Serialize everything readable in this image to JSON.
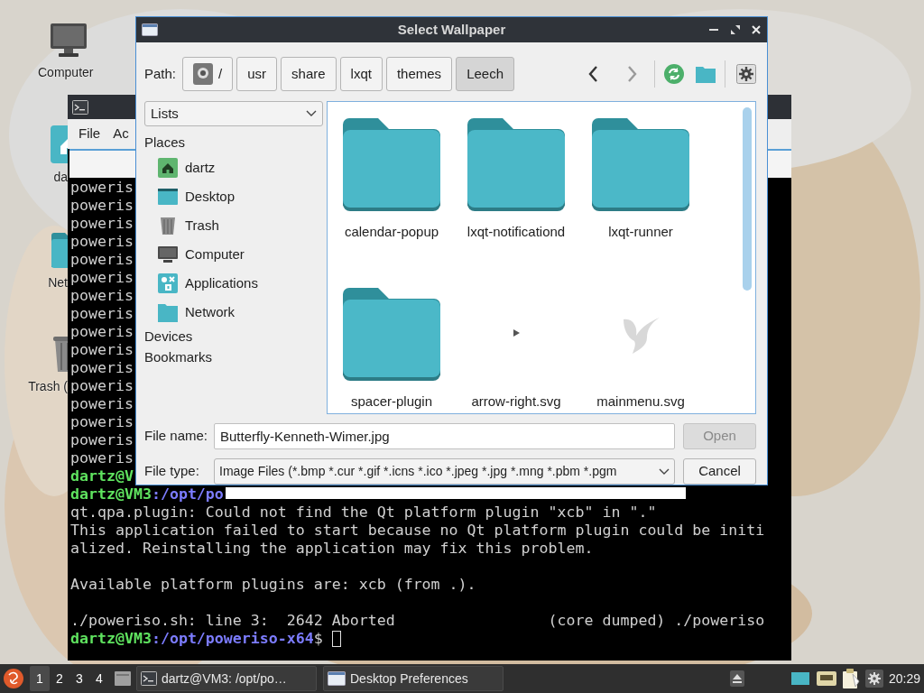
{
  "desktop_icons": [
    {
      "label": "Computer",
      "kind": "computer"
    },
    {
      "label": "da",
      "kind": "home"
    },
    {
      "label": "Net",
      "kind": "network"
    },
    {
      "label": "Trash (",
      "kind": "trash"
    }
  ],
  "terminal": {
    "menu": [
      "File",
      "Ac"
    ],
    "lines": [
      {
        "kind": "output",
        "text": "poweris"
      },
      {
        "kind": "output",
        "text": "poweris"
      },
      {
        "kind": "output",
        "text": "poweris"
      },
      {
        "kind": "output",
        "text": "poweris"
      },
      {
        "kind": "output",
        "text": "poweris"
      },
      {
        "kind": "output",
        "text": "poweris"
      },
      {
        "kind": "output",
        "text": "poweris"
      },
      {
        "kind": "output",
        "text": "poweris"
      },
      {
        "kind": "output",
        "text": "poweris"
      },
      {
        "kind": "output",
        "text": "poweris"
      },
      {
        "kind": "output",
        "text": "poweris"
      },
      {
        "kind": "output",
        "text": "poweris"
      },
      {
        "kind": "output",
        "text": "poweris"
      },
      {
        "kind": "output",
        "text": "poweris"
      },
      {
        "kind": "output",
        "text": "poweris"
      },
      {
        "kind": "output",
        "text": "poweris"
      },
      {
        "kind": "prompt",
        "user": "dartz@V"
      },
      {
        "kind": "prompt",
        "user": "dartz@VM3",
        "path": ":/opt/po"
      },
      {
        "kind": "output",
        "text": "qt.qpa.plugin: Could not find the Qt platform plugin \"xcb\" in \".\""
      },
      {
        "kind": "output",
        "text": "This application failed to start because no Qt platform plugin could be initi"
      },
      {
        "kind": "output",
        "text": "alized. Reinstalling the application may fix this problem."
      },
      {
        "kind": "blank"
      },
      {
        "kind": "output",
        "text": "Available platform plugins are: xcb (from .)."
      },
      {
        "kind": "blank"
      },
      {
        "kind": "output",
        "text": "./poweriso.sh: line 3:  2642 Aborted                 (core dumped) ./poweriso"
      },
      {
        "kind": "prompt",
        "user": "dartz@VM3",
        "path": ":/opt/poweriso-x64",
        "tail": "$ ",
        "cursor": true
      }
    ]
  },
  "dialog": {
    "title": "Select Wallpaper",
    "path_label": "Path:",
    "breadcrumbs": [
      {
        "label": "/",
        "kind": "root",
        "selected": false
      },
      {
        "label": "usr",
        "kind": "dir",
        "selected": false
      },
      {
        "label": "share",
        "kind": "dir",
        "selected": false
      },
      {
        "label": "lxqt",
        "kind": "dir",
        "selected": false
      },
      {
        "label": "themes",
        "kind": "dir",
        "selected": false
      },
      {
        "label": "Leech",
        "kind": "dir",
        "selected": true
      }
    ],
    "nav_buttons": [
      {
        "kind": "back",
        "disabled": false
      },
      {
        "kind": "forward",
        "disabled": true
      }
    ],
    "view_combo": "Lists",
    "sections": [
      {
        "title": "Places",
        "items": [
          {
            "label": "dartz",
            "kind": "home"
          },
          {
            "label": "Desktop",
            "kind": "desktop"
          },
          {
            "label": "Trash",
            "kind": "trash"
          },
          {
            "label": "Computer",
            "kind": "computer"
          },
          {
            "label": "Applications",
            "kind": "applications"
          },
          {
            "label": "Network",
            "kind": "network"
          }
        ]
      },
      {
        "title": "Devices"
      },
      {
        "title": "Bookmarks"
      }
    ],
    "files": [
      {
        "name": "calendar-popup",
        "kind": "folder"
      },
      {
        "name": "lxqt-notificationd",
        "kind": "folder"
      },
      {
        "name": "lxqt-runner",
        "kind": "folder"
      },
      {
        "name": "spacer-plugin",
        "kind": "folder"
      },
      {
        "name": "arrow-right.svg",
        "kind": "arrow"
      },
      {
        "name": "mainmenu.svg",
        "kind": "bird"
      }
    ],
    "file_name": {
      "label": "File name:",
      "value": "Butterfly-Kenneth-Wimer.jpg"
    },
    "file_type": {
      "label": "File type:",
      "value": "Image Files (*.bmp *.cur *.gif *.icns *.ico *.jpeg *.jpg *.mng *.pbm *.pgm"
    },
    "buttons": [
      {
        "label": "Open",
        "disabled": true
      },
      {
        "label": "Cancel",
        "disabled": false
      }
    ]
  },
  "taskbar": {
    "workspaces": [
      {
        "label": "1",
        "selected": true
      },
      {
        "label": "2",
        "selected": false
      },
      {
        "label": "3",
        "selected": false
      },
      {
        "label": "4",
        "selected": false
      }
    ],
    "tasks": [
      {
        "label": "dartz@VM3: /opt/po…",
        "kind": "terminal"
      },
      {
        "label": "Desktop Preferences",
        "kind": "window"
      }
    ],
    "clock": "20:29"
  }
}
